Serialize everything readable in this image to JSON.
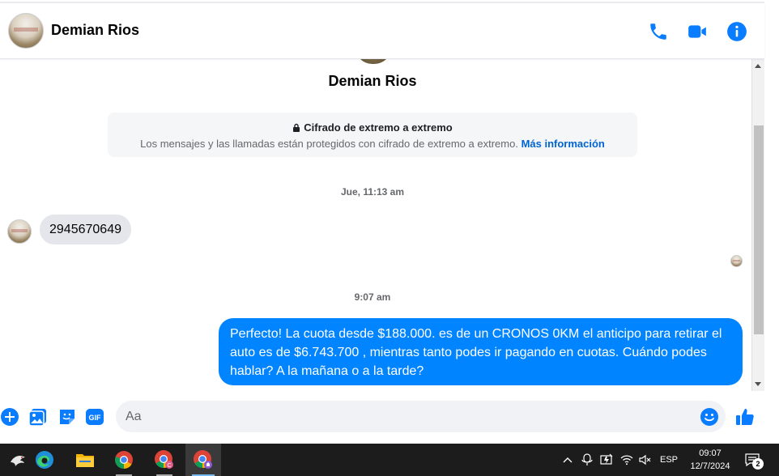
{
  "colors": {
    "accent": "#0084ff",
    "messenger_blue": "#0a7cff",
    "bubble_gray": "#e4e6eb",
    "taskbar": "#1c1c1c"
  },
  "header": {
    "contact_name": "Demian Rios",
    "icons": [
      "phone-icon",
      "video-call-icon",
      "info-icon"
    ]
  },
  "conversation": {
    "profile_name": "Demian Rios",
    "e2e": {
      "title": "Cifrado de extremo a extremo",
      "text": "Los mensajes y las llamadas están protegidos con cifrado de extremo a extremo.",
      "link": "Más información"
    },
    "messages": [
      {
        "timestamp": "Jue, 11:13 am",
        "direction": "incoming",
        "text": "2945670649"
      },
      {
        "timestamp": "9:07 am",
        "direction": "outgoing",
        "text": "Perfecto! La cuota desde $188.000. es de un CRONOS 0KM el anticipo para retirar el auto es de $6.743.700 , mientras tanto podes ir pagando en cuotas. Cuándo podes hablar? A la mañana o a la tarde?"
      }
    ]
  },
  "composer": {
    "placeholder": "Aa",
    "icons": [
      "add-icon",
      "image-icon",
      "sticker-icon",
      "gif-icon",
      "emoji-icon",
      "like-icon"
    ]
  },
  "taskbar": {
    "apps": [
      "bird-app-icon",
      "edge-icon",
      "file-explorer-icon",
      "chrome-icon",
      "chrome-profile-icon",
      "chrome-active-icon"
    ],
    "tray": {
      "language": "ESP",
      "time": "09:07",
      "date": "12/7/2024",
      "notification_count": "2"
    }
  }
}
